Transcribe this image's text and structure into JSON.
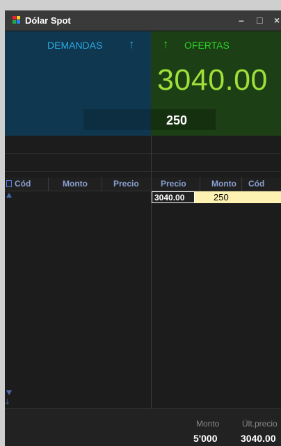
{
  "window": {
    "title": "Dólar Spot",
    "minimize_glyph": "–",
    "maximize_glyph": "□",
    "close_glyph": "×"
  },
  "demandas": {
    "label": "DEMANDAS",
    "arrow": "↑"
  },
  "ofertas": {
    "label": "OFERTAS",
    "arrow": "↑",
    "price": "3040.00",
    "quantity": "250"
  },
  "columns_left": [
    "Cód",
    "Monto",
    "Precio"
  ],
  "columns_right": [
    "Precio",
    "Monto",
    "Cód"
  ],
  "ofertas_rows": [
    {
      "precio": "3040.00",
      "monto": "250",
      "cod": ""
    }
  ],
  "footer": {
    "monto_label": "Monto",
    "monto_value": "5'000",
    "ult_precio_label": "Últ.precio",
    "ult_precio_value": "3040.00"
  },
  "colors": {
    "demandas_bg": "#0f3850",
    "ofertas_bg": "#1d3f15",
    "demandas_accent": "#2aa9e0",
    "ofertas_accent": "#2ad42a",
    "price_accent": "#9fe03a",
    "selected_row": "#fef2b3"
  }
}
